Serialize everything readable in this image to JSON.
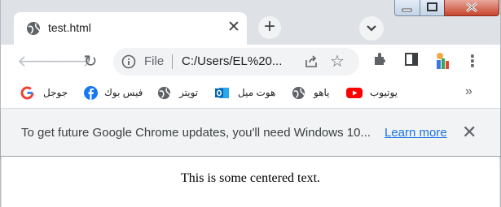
{
  "tab": {
    "title": "test.html"
  },
  "omnibox": {
    "scheme_label": "File",
    "url": "C:/Users/EL%20..."
  },
  "bookmarks": [
    {
      "label": "جوجل",
      "icon": "google-icon"
    },
    {
      "label": "فيس بوك",
      "icon": "facebook-icon"
    },
    {
      "label": "تويتر",
      "icon": "globe-icon"
    },
    {
      "label": "هوت ميل",
      "icon": "outlook-icon"
    },
    {
      "label": "ياهو",
      "icon": "globe-icon"
    },
    {
      "label": "يوتيوب",
      "icon": "youtube-icon"
    }
  ],
  "infobar": {
    "message": "To get future Google Chrome updates, you'll need Windows 10...",
    "link": "Learn more"
  },
  "page": {
    "text": "This is some centered text."
  },
  "colors": {
    "accent_link": "#1a73e8",
    "chrome_frame": "#dee1e6",
    "toolbar": "#ffffff"
  }
}
